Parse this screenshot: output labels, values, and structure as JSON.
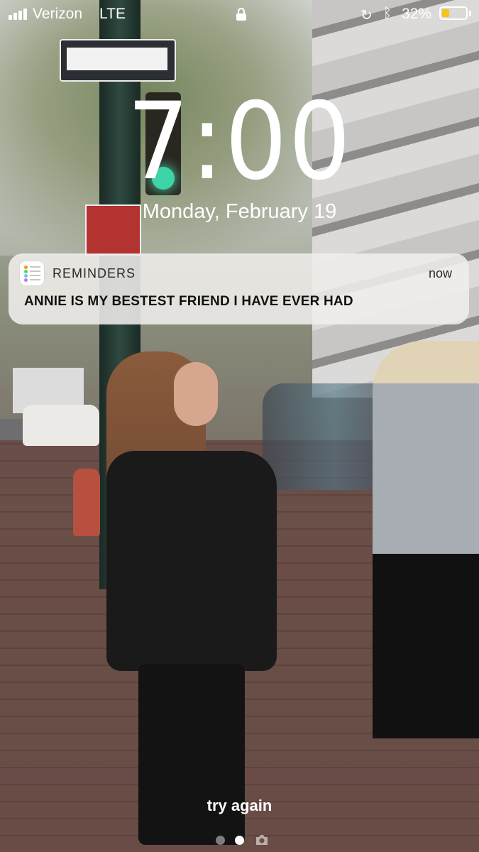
{
  "status_bar": {
    "carrier": "Verizon",
    "network": "LTE",
    "battery_percent": "32%",
    "battery_level": 0.32,
    "icons": [
      "signal-icon",
      "lock-icon",
      "orientation-lock-icon",
      "bluetooth-icon",
      "battery-icon"
    ]
  },
  "lock_screen": {
    "time": "7:00",
    "date": "Monday, February 19",
    "bottom_hint": "try again",
    "pages": {
      "count": 3,
      "current": 1
    }
  },
  "notification": {
    "app_name": "REMINDERS",
    "time": "now",
    "message": "ANNIE IS MY BESTEST FRIEND I HAVE EVER HAD",
    "icon": "reminders-app-icon"
  },
  "colors": {
    "battery_fill": "#f5c518",
    "notification_bg": "#f0eeec"
  }
}
